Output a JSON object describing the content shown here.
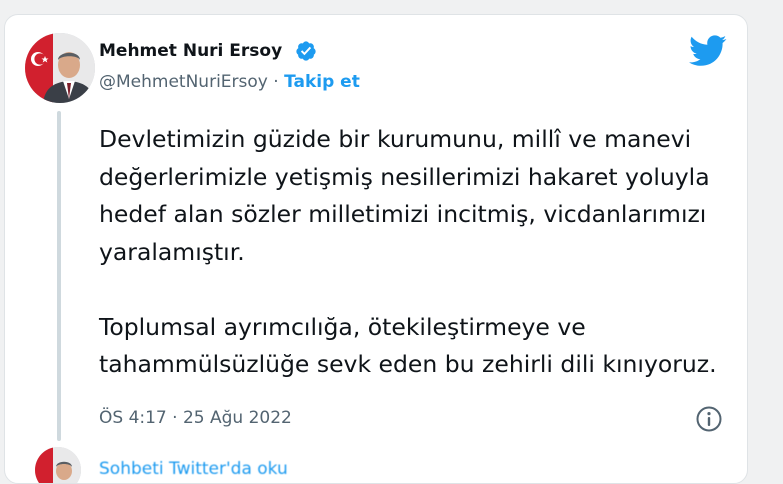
{
  "author": {
    "name": "Mehmet Nuri Ersoy",
    "handle": "@MehmetNuriErsoy",
    "separator": "·",
    "follow_label": "Takip et",
    "verified": true,
    "avatar_icon": "profile-photo-with-turkish-flag"
  },
  "tweet": {
    "paragraphs": [
      "Devletimizin güzide bir kurumunu, millî ve manevi değerlerimizle yetişmiş nesillerimizi hakaret yoluyla hedef alan sözler milletimizi incitmiş, vicdanlarımızı yaralamıştır.",
      "Toplumsal ayrımcılığa, ötekileştirmeye ve tahammülsüzlüğe sevk eden bu zehirli dili kınıyoruz."
    ],
    "timestamp": "ÖS 4:17 · 25 Ağu 2022"
  },
  "reply": {
    "partial_text": "Sohbeti Twitter'da oku"
  },
  "colors": {
    "accent": "#1d9bf0",
    "text": "#0f1419",
    "muted": "#536471",
    "thread_line": "#cfd9de",
    "background": "#f0f1f2"
  },
  "icons": [
    "verified-badge-icon",
    "twitter-bird-icon",
    "info-icon"
  ]
}
